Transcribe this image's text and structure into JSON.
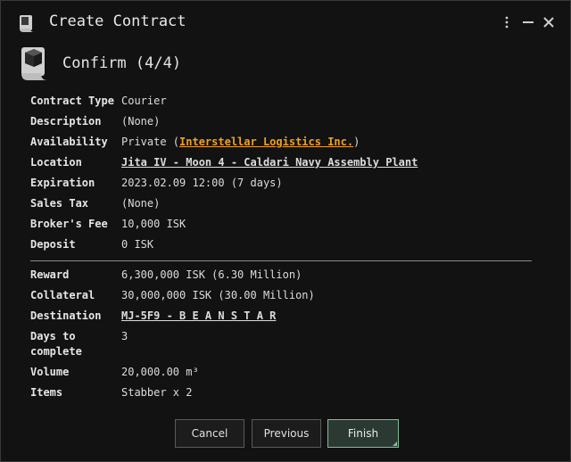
{
  "window": {
    "title": "Create Contract",
    "icons": [
      "contract-scroll-icon",
      "kebab-menu-icon",
      "minimize-icon",
      "close-icon"
    ]
  },
  "step": {
    "title": "Confirm (4/4)",
    "icon": "contract-scroll-icon"
  },
  "details": {
    "contract_type": {
      "label": "Contract Type",
      "value": "Courier"
    },
    "description": {
      "label": "Description",
      "value": "(None)"
    },
    "availability": {
      "label": "Availability",
      "prefix": "Private (",
      "link": "Interstellar Logistics Inc.",
      "suffix": ")"
    },
    "location": {
      "label": "Location",
      "link": "Jita IV - Moon 4 - Caldari Navy Assembly Plant"
    },
    "expiration": {
      "label": "Expiration",
      "value": "2023.02.09 12:00 (7 days)"
    },
    "sales_tax": {
      "label": "Sales Tax",
      "value": "(None)"
    },
    "brokers_fee": {
      "label": "Broker's Fee",
      "value": "10,000 ISK"
    },
    "deposit": {
      "label": "Deposit",
      "value": "0 ISK"
    },
    "reward": {
      "label": "Reward",
      "value": "6,300,000 ISK (6.30 Million)"
    },
    "collateral": {
      "label": "Collateral",
      "value": "30,000,000 ISK (30.00 Million)"
    },
    "destination": {
      "label": "Destination",
      "link": "MJ-5F9 - B E A N S T A R"
    },
    "days_to_complete": {
      "label_line1": "Days to",
      "label_line2": "complete",
      "value": "3"
    },
    "volume": {
      "label": "Volume",
      "value": "20,000.00 m³"
    },
    "items": {
      "label": "Items",
      "value": "Stabber x 2"
    }
  },
  "footer": {
    "cancel_label": "Cancel",
    "previous_label": "Previous",
    "finish_label": "Finish"
  },
  "colors": {
    "background": "#121212",
    "link": "#f0a020",
    "finish_border": "#7fbf9a"
  }
}
